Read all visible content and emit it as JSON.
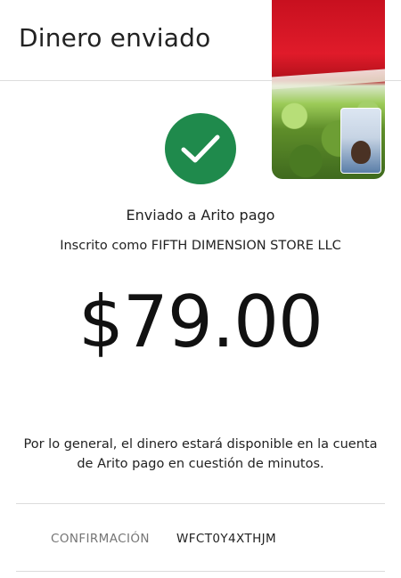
{
  "header": {
    "title": "Dinero enviado"
  },
  "status": {
    "icon": "checkmark-icon",
    "color": "#1f8a4c"
  },
  "recipient": {
    "sent_to": "Enviado a Arito pago",
    "enrolled_as": "Inscrito como FIFTH DIMENSION STORE LLC"
  },
  "payment": {
    "amount": "$79.00"
  },
  "info": {
    "note": "Por lo general, el dinero estará disponible en la cuenta de Arito pago en cuestión de minutos."
  },
  "confirmation": {
    "label": "CONFIRMACIÓN",
    "value": "WFCT0Y4XTHJM"
  }
}
